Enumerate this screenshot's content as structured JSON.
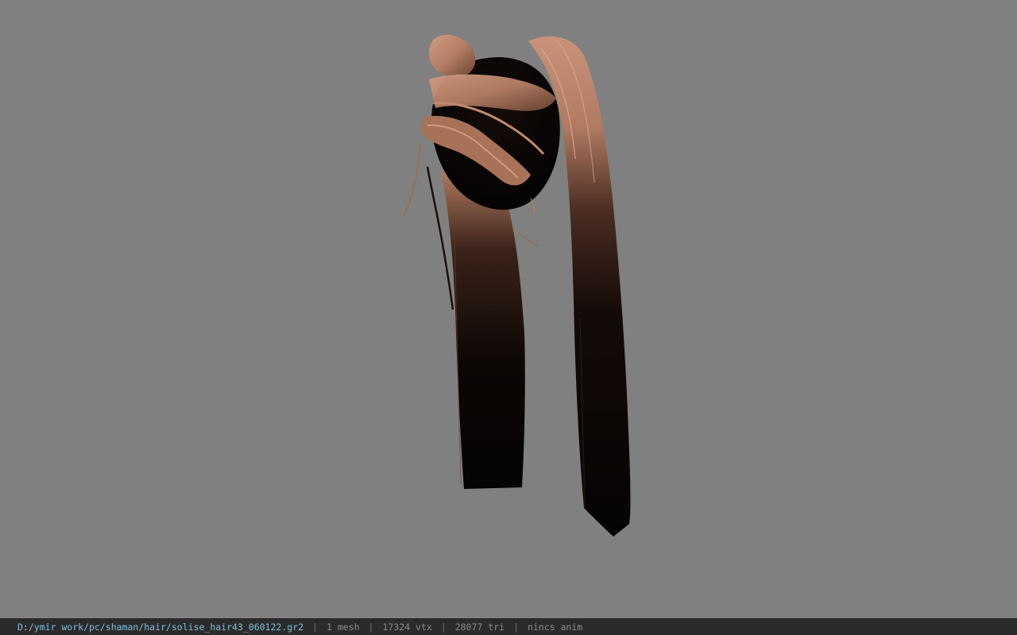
{
  "status_bar": {
    "file_path": "D:/ymir work/pc/shaman/hair/solise_hair43_060122.gr2",
    "separator": "|",
    "mesh_count": "1 mesh",
    "vertex_count": "17324 vtx",
    "triangle_count": "28077 tri",
    "animation": "nincs anim"
  },
  "viewport": {
    "background_color": "#808080",
    "model": "hair-mesh",
    "hair_tip_color": "#c08a6e",
    "hair_shadow_color": "#0a0605"
  }
}
